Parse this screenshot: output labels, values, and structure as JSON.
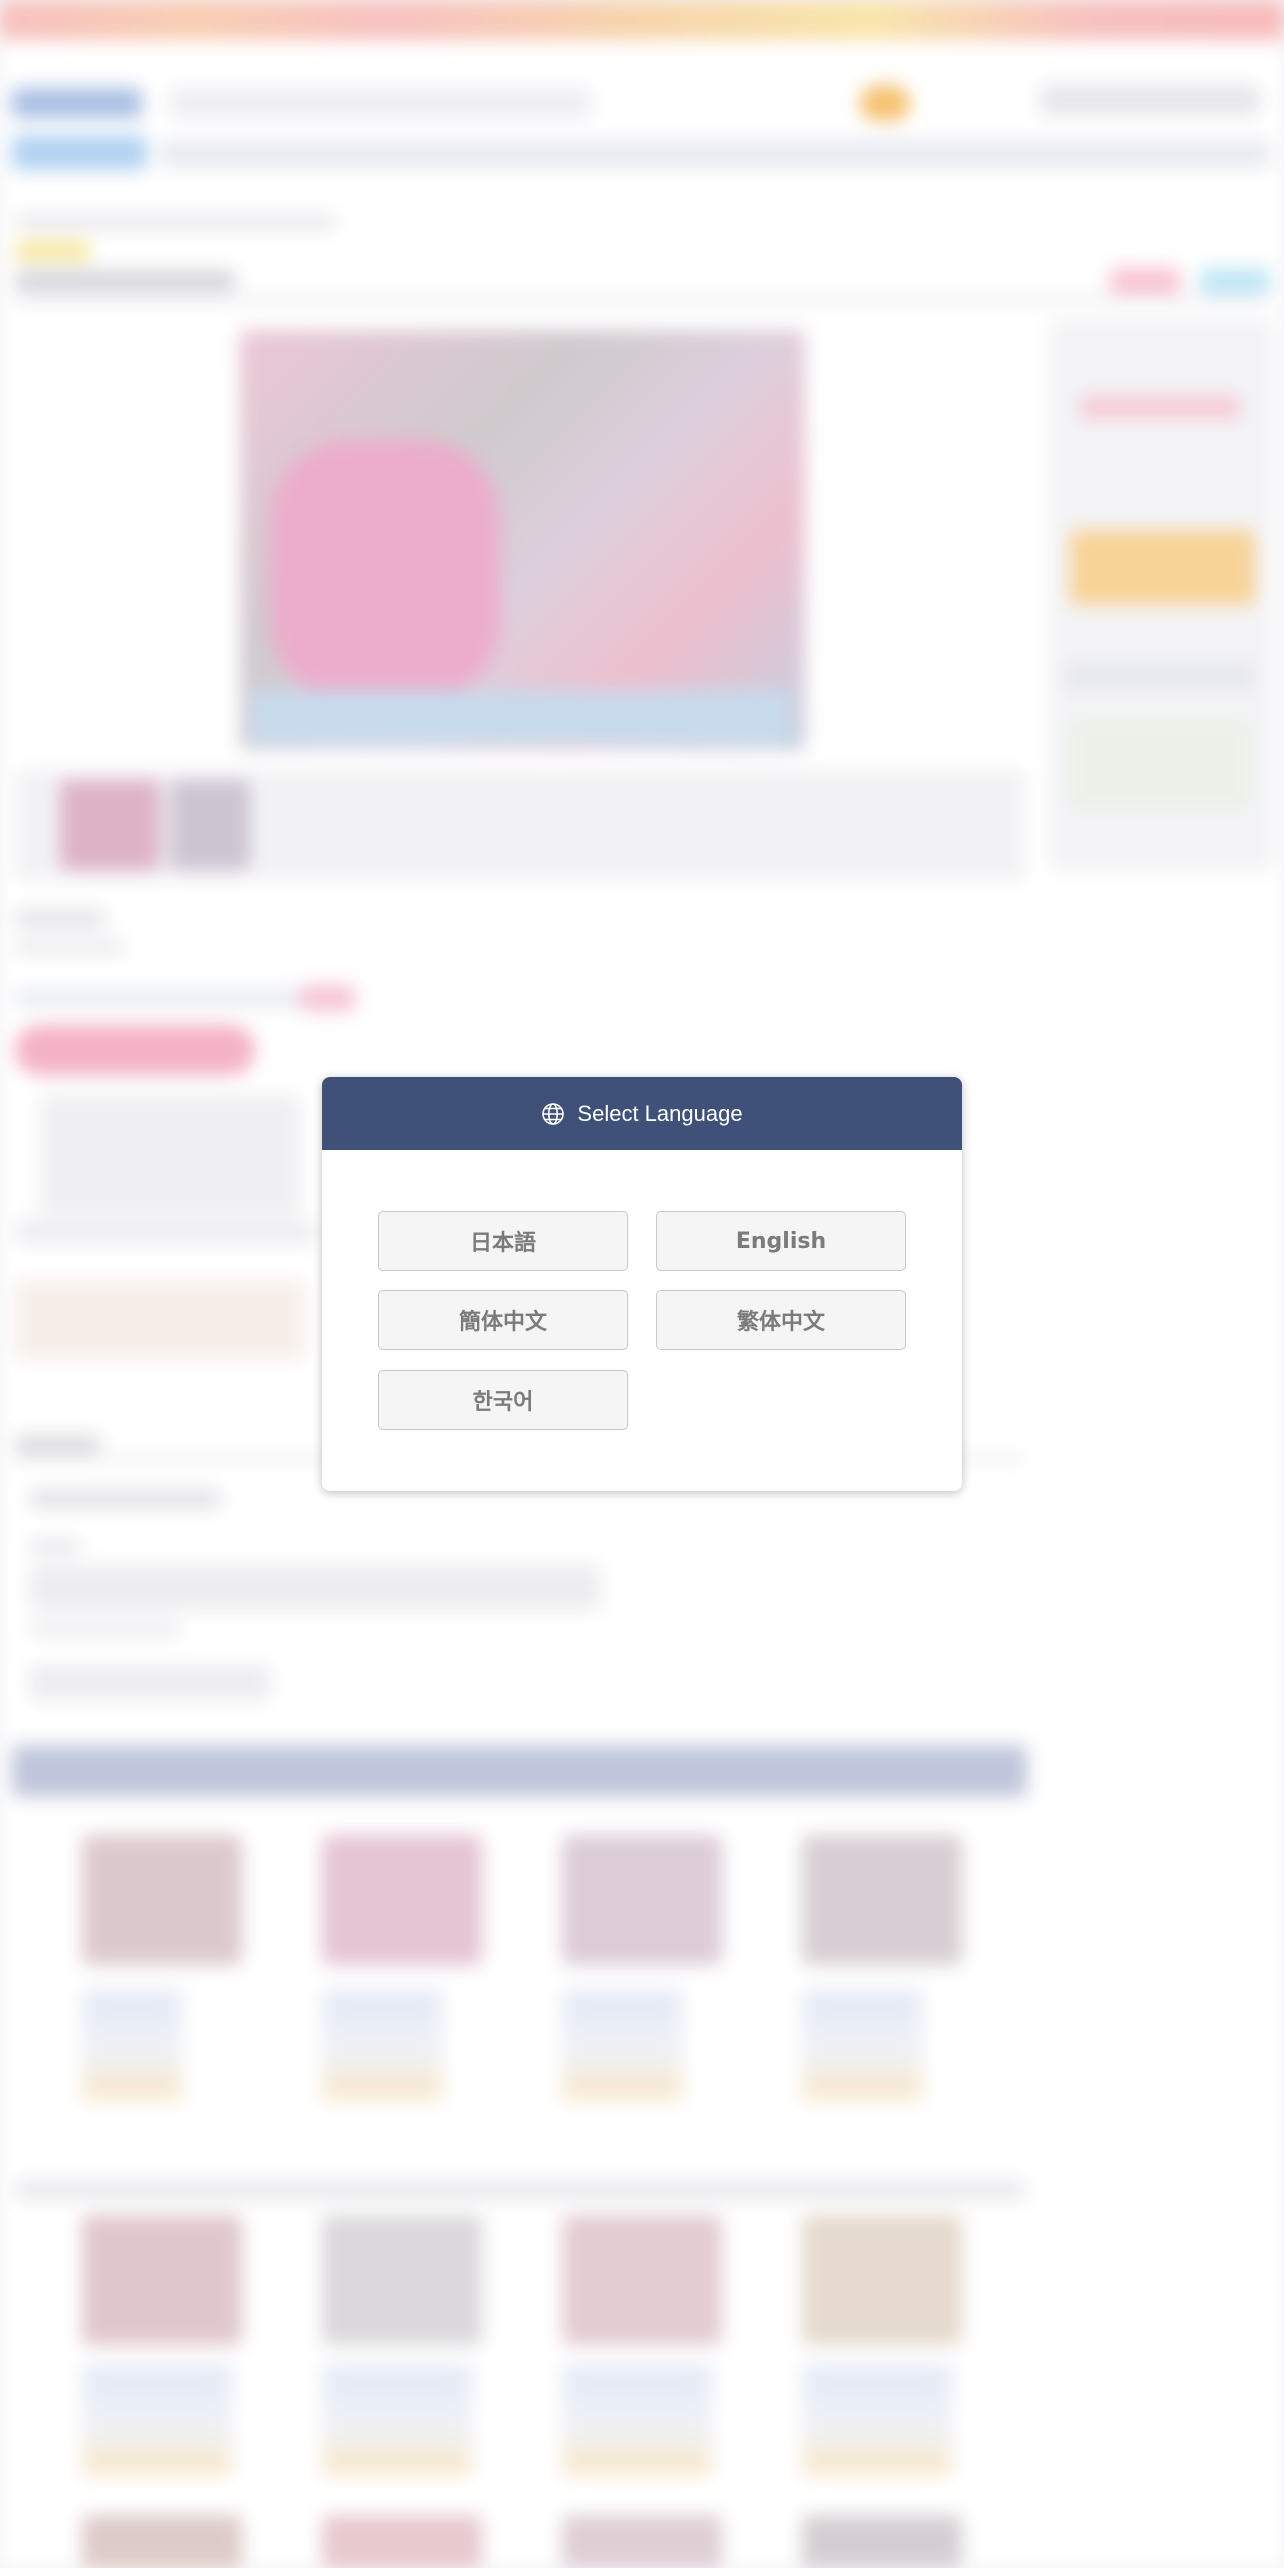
{
  "modal": {
    "title": "Select Language",
    "icon": "globe-icon",
    "languages": [
      {
        "code": "ja",
        "label": "日本語"
      },
      {
        "code": "en",
        "label": "English"
      },
      {
        "code": "zh-Hans",
        "label": "簡体中文"
      },
      {
        "code": "zh-Hant",
        "label": "繁体中文"
      },
      {
        "code": "ko",
        "label": "한국어"
      }
    ]
  },
  "colors": {
    "modal_header": "#3f5079",
    "button_bg": "#f5f5f5",
    "button_text": "#7b7b7b"
  }
}
